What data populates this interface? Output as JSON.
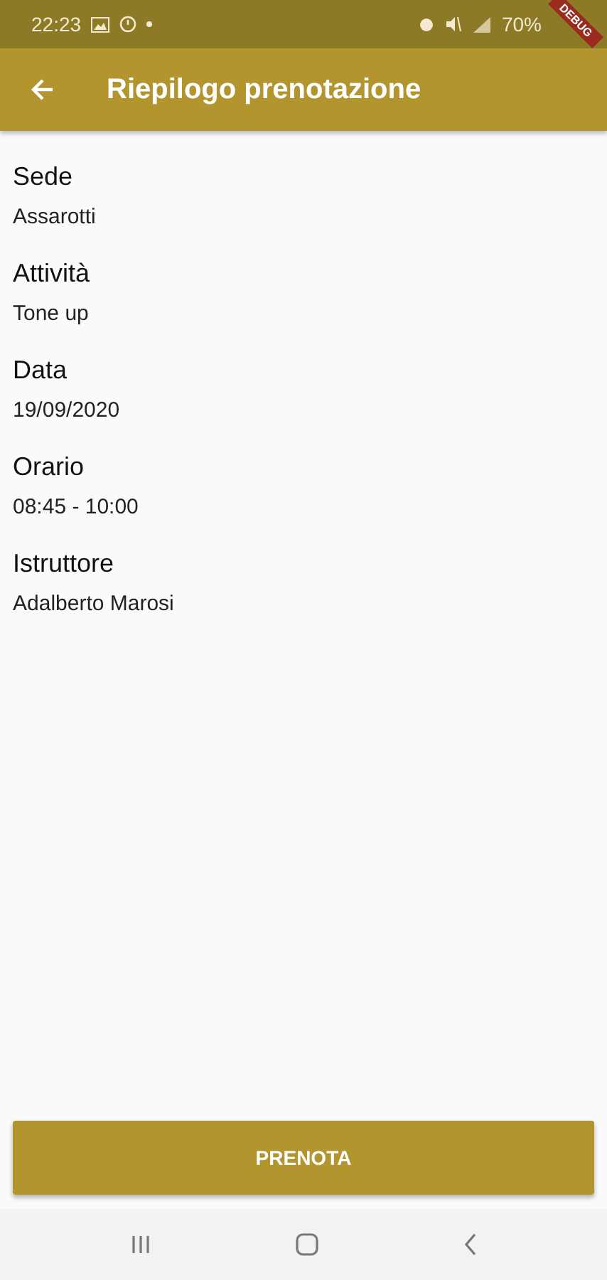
{
  "status_bar": {
    "time": "22:23",
    "battery": "70%"
  },
  "debug_banner": "DEBUG",
  "app_bar": {
    "title": "Riepilogo prenotazione"
  },
  "fields": [
    {
      "label": "Sede",
      "value": "Assarotti"
    },
    {
      "label": "Attività",
      "value": "Tone up"
    },
    {
      "label": "Data",
      "value": "19/09/2020"
    },
    {
      "label": "Orario",
      "value": "08:45 - 10:00"
    },
    {
      "label": "Istruttore",
      "value": "Adalberto Marosi"
    }
  ],
  "button": "PRENOTA"
}
